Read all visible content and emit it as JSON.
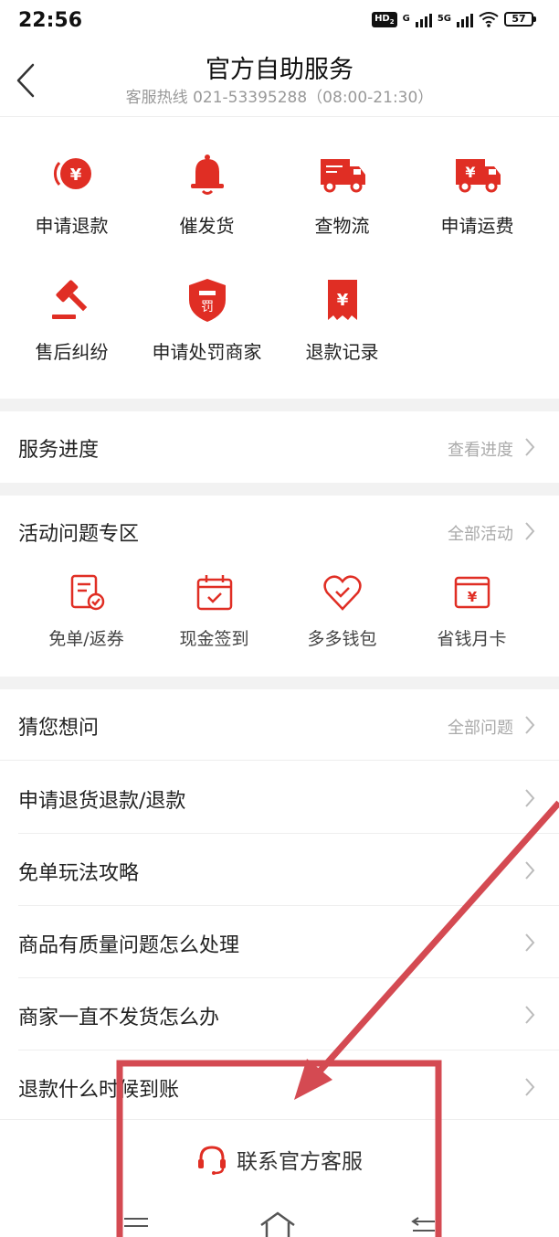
{
  "status_bar": {
    "time": "22:56",
    "net1": "G",
    "net2": "5G",
    "battery": "57"
  },
  "header": {
    "title": "官方自助服务",
    "subtitle": "客服热线 021-53395288（08:00-21:30）"
  },
  "services": [
    {
      "label": "申请退款",
      "icon": "refund-yen-icon"
    },
    {
      "label": "催发货",
      "icon": "bell-icon"
    },
    {
      "label": "查物流",
      "icon": "truck-icon"
    },
    {
      "label": "申请运费",
      "icon": "truck-yen-icon"
    },
    {
      "label": "售后纠纷",
      "icon": "gavel-icon"
    },
    {
      "label": "申请处罚商家",
      "icon": "penalty-shield-icon"
    },
    {
      "label": "退款记录",
      "icon": "receipt-yen-icon"
    }
  ],
  "progress": {
    "title": "服务进度",
    "link": "查看进度"
  },
  "activity": {
    "title": "活动问题专区",
    "link": "全部活动",
    "items": [
      {
        "label": "免单/返券",
        "icon": "free-order-icon"
      },
      {
        "label": "现金签到",
        "icon": "calendar-check-icon"
      },
      {
        "label": "多多钱包",
        "icon": "heart-wallet-icon"
      },
      {
        "label": "省钱月卡",
        "icon": "monthly-card-icon"
      }
    ]
  },
  "faq": {
    "title": "猜您想问",
    "link": "全部问题",
    "items": [
      "申请退货退款/退款",
      "免单玩法攻略",
      "商品有质量问题怎么处理",
      "商家一直不发货怎么办",
      "退款什么时候到账"
    ]
  },
  "contact": {
    "label": "联系官方客服"
  },
  "colors": {
    "accent": "#e02e24",
    "annotation": "#d44a52"
  }
}
